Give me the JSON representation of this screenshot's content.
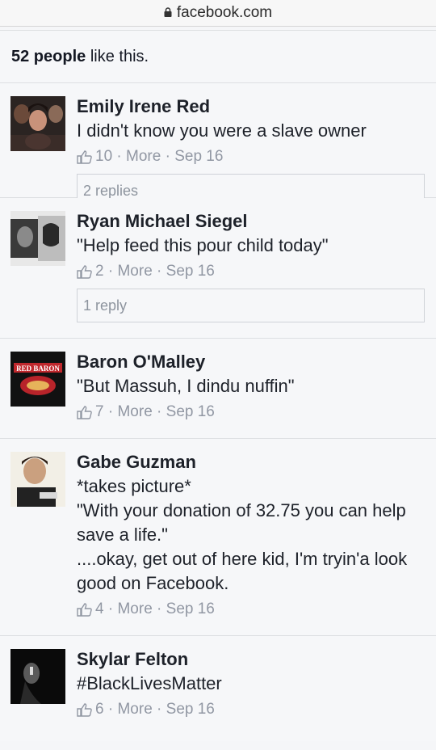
{
  "browser": {
    "url": "facebook.com"
  },
  "likes": {
    "count": "52 people",
    "suffix": " like this."
  },
  "comments": [
    {
      "author": "Emily Irene Red",
      "text": "I didn't know you were a slave owner",
      "like_count": "10",
      "more": "More",
      "date": "Sep 16",
      "replies": "2 replies"
    },
    {
      "author": "Ryan Michael Siegel",
      "text": "\"Help feed this pour child today\"",
      "like_count": "2",
      "more": "More",
      "date": "Sep 16",
      "replies": "1 reply"
    },
    {
      "author": "Baron O'Malley",
      "text": "\"But Massuh, I dindu nuffin\"",
      "like_count": "7",
      "more": "More",
      "date": "Sep 16",
      "avatar_text": "RED BARON"
    },
    {
      "author": "Gabe Guzman",
      "text_lines": [
        "*takes picture*",
        "\"With your donation of 32.75 you can help save a life.\"",
        "....okay, get out of here kid, I'm tryin'a look good on Facebook."
      ],
      "like_count": "4",
      "more": "More",
      "date": "Sep 16"
    },
    {
      "author": "Skylar Felton",
      "text": "#BlackLivesMatter",
      "like_count": "6",
      "more": "More",
      "date": "Sep 16"
    }
  ],
  "separator": " · "
}
